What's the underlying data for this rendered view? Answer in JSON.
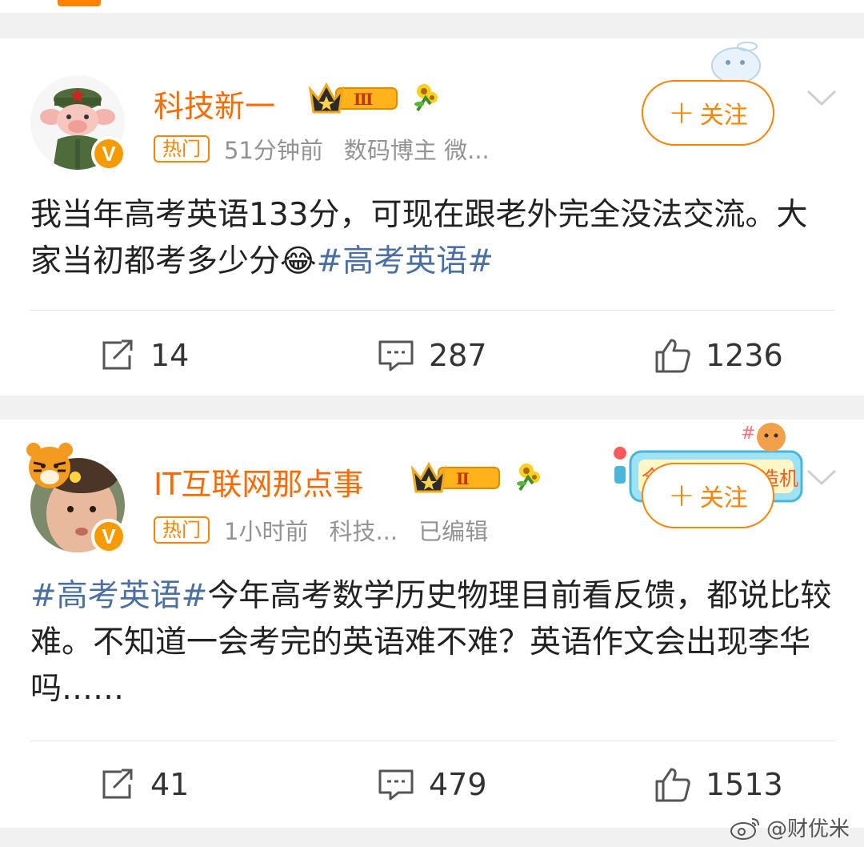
{
  "posts": [
    {
      "username": "科技新一",
      "crown_level": "Ⅲ",
      "hot_tag": "热门",
      "time": "51分钟前",
      "source": "数码博主 微...",
      "edited": "",
      "follow_label": "关注",
      "content_before": "我当年高考英语133分，可现在跟老外完全没法交流。大家当初都考多少分",
      "emoji": "😂",
      "topic": "#高考英语#",
      "content_after": "",
      "shares": "14",
      "comments": "287",
      "likes": "1236"
    },
    {
      "username": "IT互联网那点事",
      "crown_level": "Ⅱ",
      "hot_tag": "热门",
      "time": "1小时前",
      "source": "科技...",
      "edited": "已编辑",
      "follow_label": "关注",
      "topic": "#高考英语#",
      "content_after": "今年高考数学历史物理目前看反馈，都说比较难。不知道一会考完的英语难不难？英语作文会出现李华吗……",
      "shares": "41",
      "comments": "479",
      "likes": "1513"
    }
  ],
  "watermark": "@财优米",
  "icons": {
    "share": "share-icon",
    "comment": "comment-icon",
    "like": "like-icon",
    "more": "chevron-down-icon",
    "verified": "verified-v-icon"
  },
  "colors": {
    "accent": "#ff8200",
    "username": "#ff6a00",
    "topic": "#4a6fa5",
    "meta": "#939393"
  }
}
